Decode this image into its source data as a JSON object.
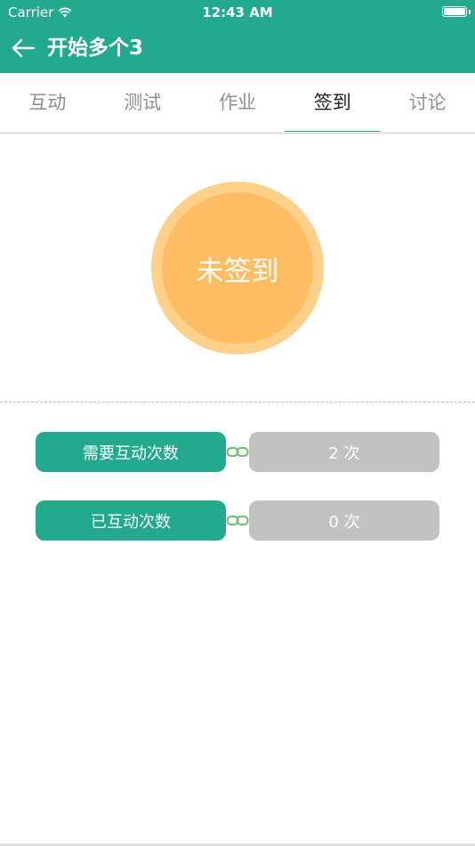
{
  "status_bar": {
    "carrier": "Carrier",
    "time": "12:43 AM"
  },
  "header": {
    "title": "开始多个3",
    "back_icon": "arrow-left-icon",
    "color": "#22a98e"
  },
  "tabs": [
    {
      "label": "互动",
      "active": false
    },
    {
      "label": "测试",
      "active": false
    },
    {
      "label": "作业",
      "active": false
    },
    {
      "label": "签到",
      "active": true
    },
    {
      "label": "讨论",
      "active": false
    }
  ],
  "signin": {
    "label": "未签到",
    "outer_color": "#ffd08a",
    "inner_color": "#ffbd63"
  },
  "stats": [
    {
      "label": "需要互动次数",
      "value": "2 次",
      "link_icon": "chain-link-icon"
    },
    {
      "label": "已互动次数",
      "value": "0 次",
      "link_icon": "chain-link-icon"
    }
  ],
  "colors": {
    "accent": "#22a98e",
    "value_bg": "#c2c2c2"
  }
}
